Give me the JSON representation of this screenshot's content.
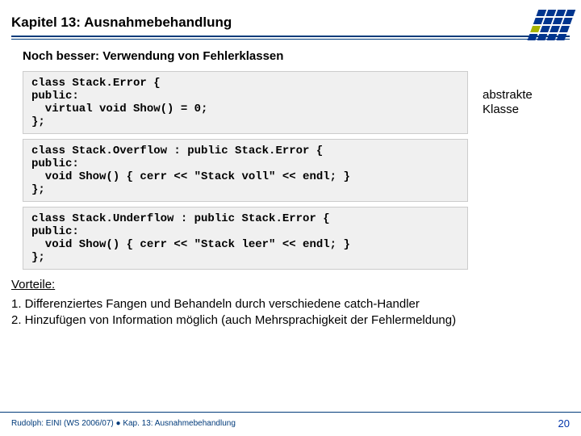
{
  "header": {
    "chapter": "Kapitel 13: Ausnahmebehandlung",
    "subheading": "Noch besser: Verwendung von Fehlerklassen"
  },
  "code": {
    "block1": "class Stack.Error {\npublic:\n  virtual void Show() = 0;\n};",
    "annotation1": "abstrakte\nKlasse",
    "block2": "class Stack.Overflow : public Stack.Error {\npublic:\n  void Show() { cerr << \"Stack voll\" << endl; }\n};",
    "block3": "class Stack.Underflow : public Stack.Error {\npublic:\n  void Show() { cerr << \"Stack leer\" << endl; }\n};"
  },
  "advantages": {
    "label": "Vorteile:",
    "item1": "1. Differenziertes Fangen und Behandeln durch verschiedene catch-Handler",
    "item2": "2. Hinzufügen von Information möglich (auch Mehrsprachigkeit der Fehlermeldung)"
  },
  "footer": {
    "left": "Rudolph: EINI (WS 2006/07)  ●  Kap. 13: Ausnahmebehandlung",
    "page": "20"
  }
}
